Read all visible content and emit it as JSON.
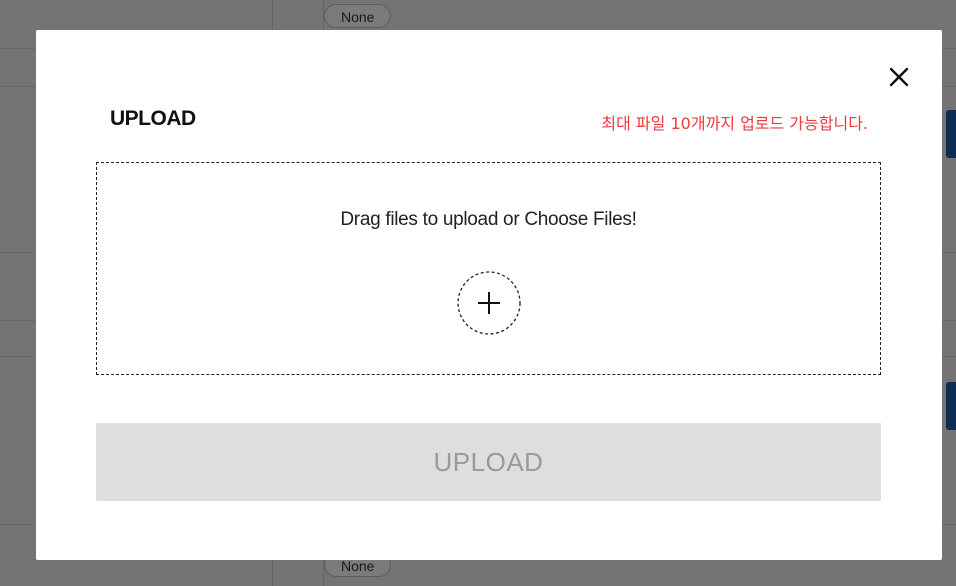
{
  "background": {
    "pill_top_label": "None",
    "pill_bottom_label": "None"
  },
  "modal": {
    "title": "UPLOAD",
    "limit_notice": "최대 파일 10개까지 업로드 가능합니다.",
    "dropzone_text": "Drag files to upload or Choose Files!",
    "upload_button_label": "UPLOAD",
    "close_icon": "close-icon",
    "add_icon": "plus-icon",
    "colors": {
      "notice": "#ee3a3a",
      "button_bg": "#dedede",
      "button_text": "#9a9a9a"
    }
  }
}
